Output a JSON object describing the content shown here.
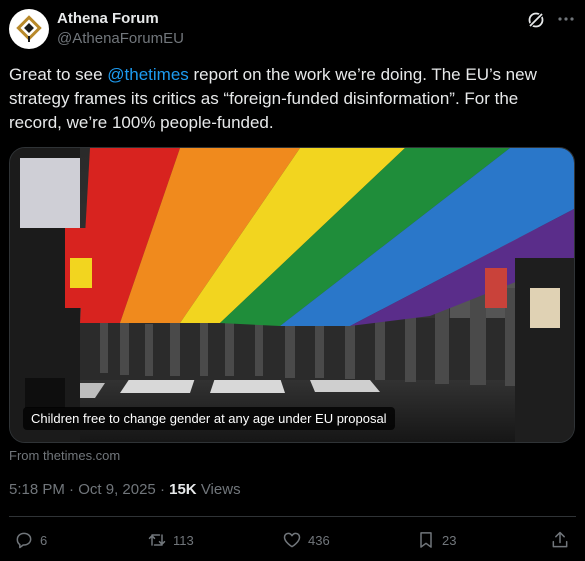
{
  "author": {
    "name": "Athena Forum",
    "handle": "@AthenaForumEU",
    "avatar_icon": "athena-logo-icon"
  },
  "post": {
    "text_before_mention": "Great to see ",
    "mention": "@thetimes",
    "text_after_mention": " report on the work we’re doing. The EU’s new strategy frames its critics as “foreign-funded disinformation”. For the record, we’re 100% people-funded."
  },
  "media": {
    "image_subject": "rainbow-flag-crowd-photo",
    "caption": "Children free to change gender at any age under EU proposal",
    "source": "From thetimes.com"
  },
  "meta": {
    "time": "5:18 PM",
    "separator": " · ",
    "date": "Oct 9, 2025",
    "views_count": "15K",
    "views_label": " Views"
  },
  "actions": {
    "replies": "6",
    "reposts": "113",
    "likes": "436",
    "bookmarks": "23"
  },
  "colors": {
    "background": "#000000",
    "text": "#e7e9ea",
    "muted": "#71767b",
    "link": "#1d9bf0",
    "divider": "#2f3336"
  }
}
